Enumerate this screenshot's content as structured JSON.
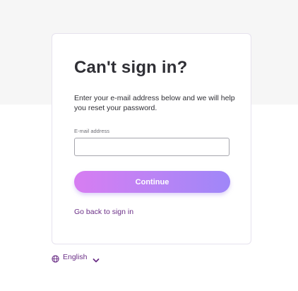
{
  "form": {
    "title": "Can't sign in?",
    "description": "Enter your e-mail address below and we will help you reset your password.",
    "email_label": "E-mail address",
    "email_value": "",
    "email_placeholder": "",
    "continue_label": "Continue",
    "back_link_label": "Go back to sign in"
  },
  "language": {
    "selected": "English",
    "globe_icon": "globe-icon",
    "chevron_icon": "chevron-down-icon"
  },
  "colors": {
    "page_top_band": "#f6f6f6",
    "card_border": "#e6e2ee",
    "button_gradient_start": "#d77df2",
    "button_gradient_end": "#9f86f8",
    "link": "#6a2e86",
    "text": "#2f2f35"
  }
}
